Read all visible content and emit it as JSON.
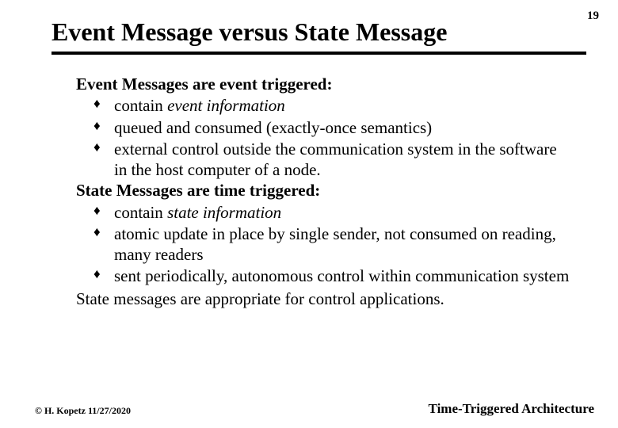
{
  "page_number": "19",
  "title": "Event Message versus  State Message",
  "section1": {
    "heading": "Event Messages are event triggered:",
    "b1_pre": "contain ",
    "b1_em": "event information",
    "b2": "queued and consumed (exactly-once semantics)",
    "b3": "external control outside the communication system in  the software in the host computer of a node."
  },
  "section2": {
    "heading": "State Messages are time triggered:",
    "b1_pre": "contain ",
    "b1_em": "state information",
    "b2": "atomic update in place by single sender, not consumed on reading, many readers",
    "b3": "sent periodically, autonomous control within communication system"
  },
  "closing": "State messages are  appropriate for  control applications.",
  "footer_left": "© H. Kopetz  11/27/2020",
  "footer_right": "Time-Triggered Architecture"
}
